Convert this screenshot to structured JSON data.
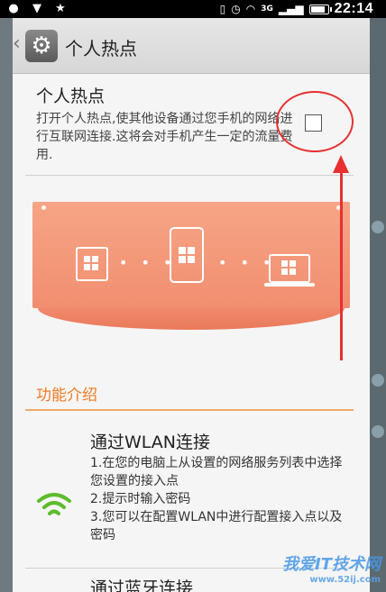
{
  "status_bar": {
    "network": "3G",
    "time": "22:14",
    "battery_level": 0.9
  },
  "header": {
    "back_glyph": "‹",
    "title": "个人热点"
  },
  "hotspot": {
    "title": "个人热点",
    "description": "打开个人热点,使其他设备通过您手机的网络进行互联网连接.这将会对手机产生一定的流量费用.",
    "enabled": false
  },
  "section": {
    "title": "功能介绍"
  },
  "features": [
    {
      "title": "通过WLAN连接",
      "steps": [
        "1.在您的电脑上从设置的网络服务列表中选择您设置的接入点",
        "2.提示时输入密码",
        "3.您可以在配置WLAN中进行配置接入点以及密码"
      ]
    },
    {
      "title": "通过蓝牙连接"
    }
  ],
  "watermark": {
    "text": "我爱IT技术网",
    "url": "www.52ij.com"
  },
  "colors": {
    "accent": "#f07a22",
    "banner": "#f18e70",
    "annotation": "#e83030",
    "wifi": "#5dbb2c"
  },
  "icons": {
    "header": "gear-icon",
    "checkbox": "checkbox-icon",
    "feature_1": "wifi-icon"
  }
}
